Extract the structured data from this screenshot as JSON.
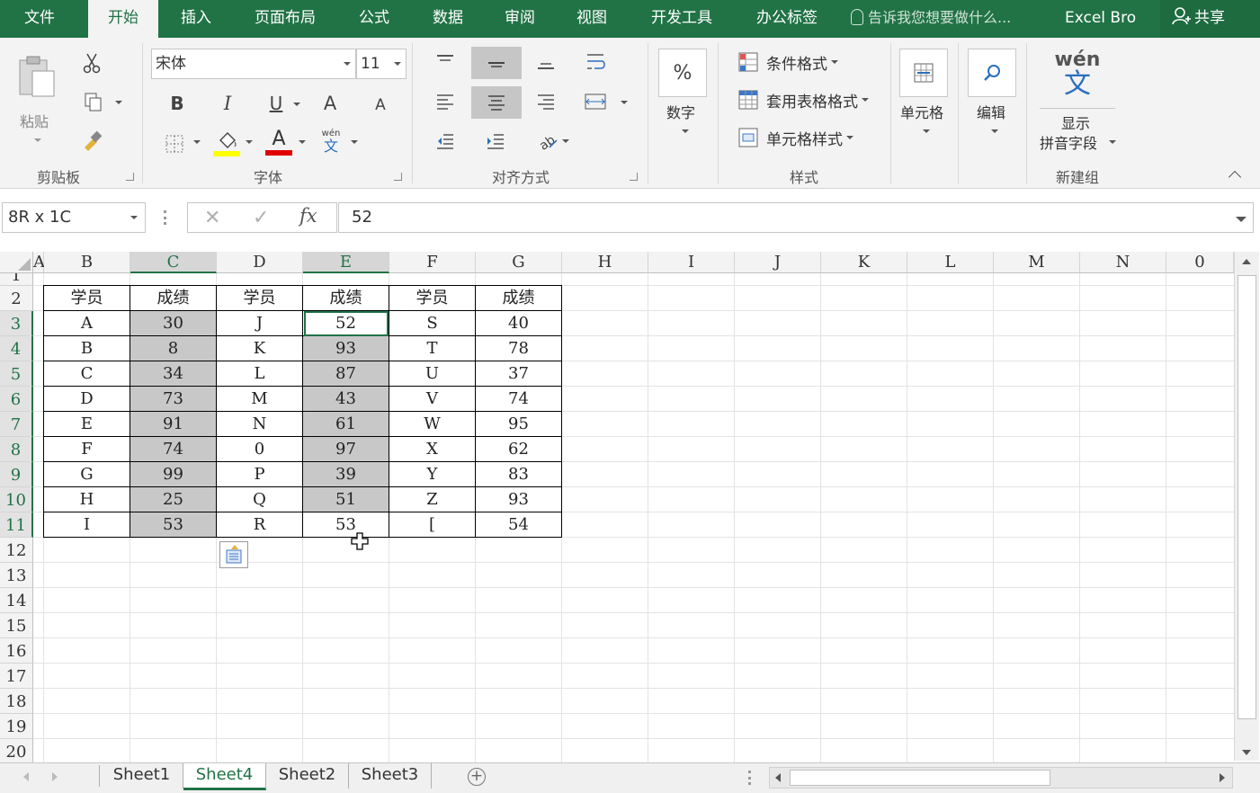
{
  "tabs": [
    "文件",
    "开始",
    "插入",
    "页面布局",
    "公式",
    "数据",
    "审阅",
    "视图",
    "开发工具",
    "办公标签"
  ],
  "active_tab": "开始",
  "tell_me": "告诉我您想要做什么...",
  "user": "Excel Bro",
  "share": "共享",
  "ribbon": {
    "clipboard": {
      "paste": "粘贴",
      "label": "剪贴板"
    },
    "font": {
      "name": "宋体",
      "size": "11",
      "label": "字体",
      "bold": "B",
      "italic": "I",
      "underline": "U",
      "grow": "A",
      "shrink": "A",
      "color_a": "A",
      "phonetic_small": "wén",
      "phonetic_big": "文"
    },
    "alignment": {
      "label": "对齐方式"
    },
    "number": {
      "symbol": "%",
      "label": "数字"
    },
    "styles": {
      "conditional": "条件格式",
      "table": "套用表格格式",
      "cell": "单元格样式",
      "label": "样式"
    },
    "cells": {
      "label": "单元格"
    },
    "editing": {
      "label": "编辑"
    },
    "newgroup": {
      "phonetic": "wén",
      "char": "文",
      "line1": "显示",
      "line2": "拼音字段",
      "label": "新建组"
    }
  },
  "formula_bar": {
    "name_box": "8R x 1C",
    "value": "52",
    "fx": "fx"
  },
  "columns": [
    "A",
    "B",
    "C",
    "D",
    "E",
    "F",
    "G",
    "H",
    "I",
    "J",
    "K",
    "L",
    "M",
    "N",
    "0"
  ],
  "rows": [
    "1",
    "2",
    "3",
    "4",
    "5",
    "6",
    "7",
    "8",
    "9",
    "10",
    "11",
    "12",
    "13",
    "14",
    "15",
    "16",
    "17",
    "18",
    "19",
    "20"
  ],
  "table": {
    "header": [
      "学员",
      "成绩",
      "学员",
      "成绩",
      "学员",
      "成绩"
    ],
    "rows": [
      [
        "A",
        "30",
        "J",
        "52",
        "S",
        "40"
      ],
      [
        "B",
        "8",
        "K",
        "93",
        "T",
        "78"
      ],
      [
        "C",
        "34",
        "L",
        "87",
        "U",
        "37"
      ],
      [
        "D",
        "73",
        "M",
        "43",
        "V",
        "74"
      ],
      [
        "E",
        "91",
        "N",
        "61",
        "W",
        "95"
      ],
      [
        "F",
        "74",
        "0",
        "97",
        "X",
        "62"
      ],
      [
        "G",
        "99",
        "P",
        "39",
        "Y",
        "83"
      ],
      [
        "H",
        "25",
        "Q",
        "51",
        "Z",
        "93"
      ],
      [
        "I",
        "53",
        "R",
        "53",
        "[",
        "54"
      ]
    ]
  },
  "sheets": [
    "Sheet1",
    "Sheet4",
    "Sheet2",
    "Sheet3"
  ],
  "active_sheet": "Sheet4",
  "colors": {
    "excel_green": "#217346",
    "selection_gray": "#c8c8c8"
  }
}
